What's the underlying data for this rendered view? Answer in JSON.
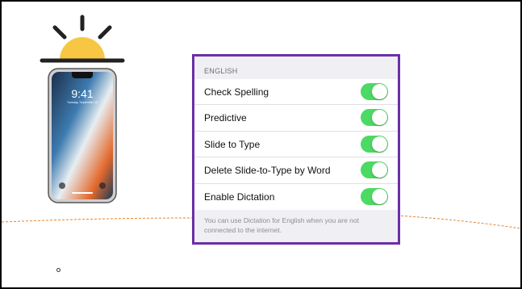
{
  "slide": {
    "accent_dashed_line": "#e8842a",
    "panel_border": "#6b2fa6"
  },
  "sun_icon": {
    "name": "sun-icon",
    "color": "#f7c744"
  },
  "phone": {
    "icon": "iphone-x-image",
    "time": "9:41",
    "date": "Tuesday, September 12"
  },
  "settings": {
    "section_header": "ENGLISH",
    "toggle_color": "#4cd964",
    "rows": [
      {
        "label": "Check Spelling",
        "on": true
      },
      {
        "label": "Predictive",
        "on": true
      },
      {
        "label": "Slide to Type",
        "on": true
      },
      {
        "label": "Delete Slide-to-Type by Word",
        "on": true
      },
      {
        "label": "Enable Dictation",
        "on": true
      }
    ],
    "footer": "You can use Dictation for English when you are not connected to the internet."
  }
}
